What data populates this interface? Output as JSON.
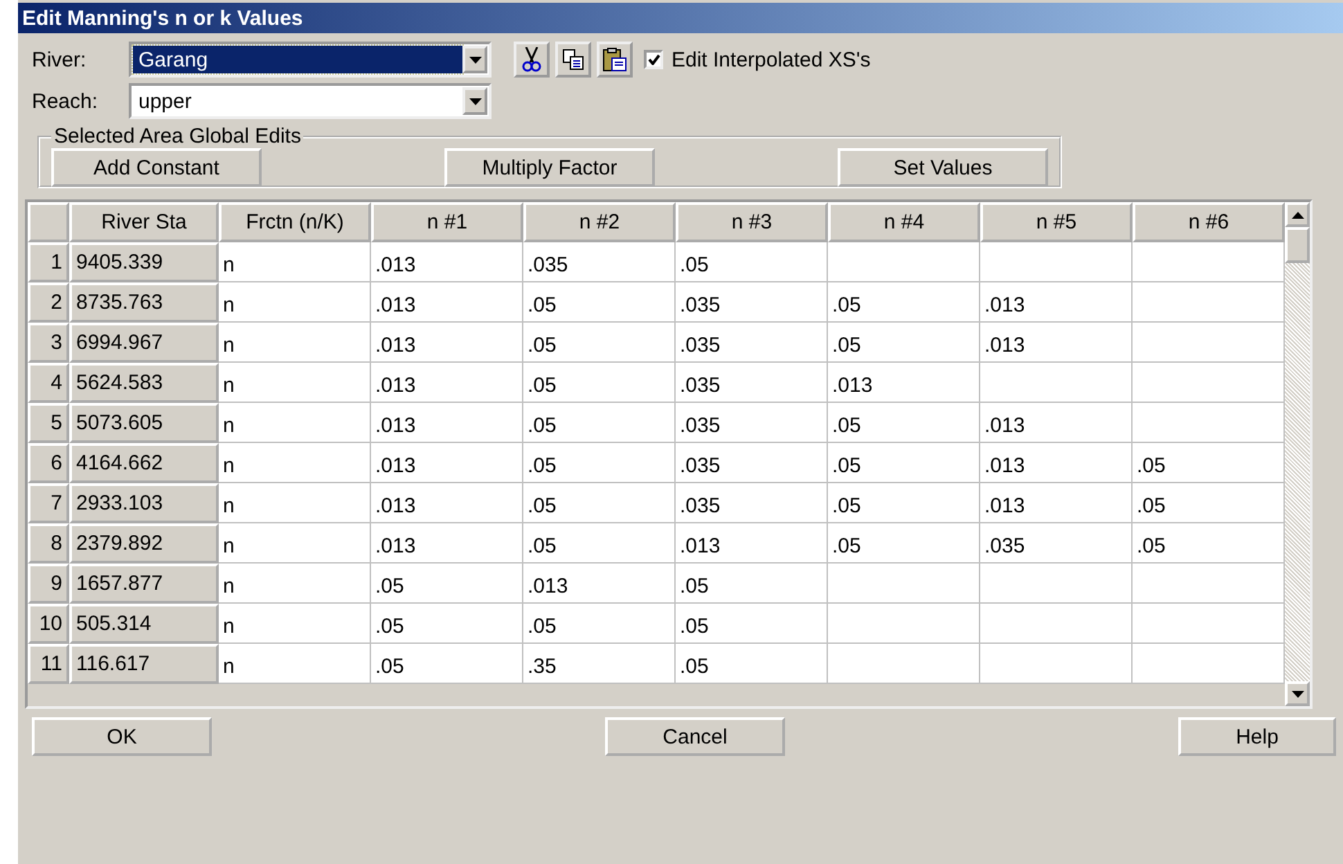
{
  "window": {
    "title": "Edit Manning's n or k Values"
  },
  "river": {
    "label": "River:",
    "value": "Garang",
    "focused": true
  },
  "reach": {
    "label": "Reach:",
    "value": "upper",
    "focused": false
  },
  "toolbar": [
    {
      "kind": "cut"
    },
    {
      "kind": "copy"
    },
    {
      "kind": "paste"
    }
  ],
  "edit_interpolated": {
    "label": "Edit Interpolated XS's",
    "checked": true
  },
  "global_edits": {
    "title": "Selected Area Global Edits",
    "buttons": [
      "Add Constant",
      "Multiply Factor",
      "Set Values"
    ]
  },
  "table": {
    "columns": [
      "River Sta",
      "Frctn (n/K)",
      "n #1",
      "n #2",
      "n #3",
      "n #4",
      "n #5",
      "n #6"
    ],
    "rows": [
      {
        "number": "1",
        "cells": [
          "9405.339",
          "n",
          ".013",
          ".035",
          ".05",
          "",
          "",
          ""
        ]
      },
      {
        "number": "2",
        "cells": [
          "8735.763",
          "n",
          ".013",
          ".05",
          ".035",
          ".05",
          ".013",
          ""
        ]
      },
      {
        "number": "3",
        "cells": [
          "6994.967",
          "n",
          ".013",
          ".05",
          ".035",
          ".05",
          ".013",
          ""
        ]
      },
      {
        "number": "4",
        "cells": [
          "5624.583",
          "n",
          ".013",
          ".05",
          ".035",
          ".013",
          "",
          ""
        ]
      },
      {
        "number": "5",
        "cells": [
          "5073.605",
          "n",
          ".013",
          ".05",
          ".035",
          ".05",
          ".013",
          ""
        ]
      },
      {
        "number": "6",
        "cells": [
          "4164.662",
          "n",
          ".013",
          ".05",
          ".035",
          ".05",
          ".013",
          ".05"
        ]
      },
      {
        "number": "7",
        "cells": [
          "2933.103",
          "n",
          ".013",
          ".05",
          ".035",
          ".05",
          ".013",
          ".05"
        ]
      },
      {
        "number": "8",
        "cells": [
          "2379.892",
          "n",
          ".013",
          ".05",
          ".013",
          ".05",
          ".035",
          ".05"
        ]
      },
      {
        "number": "9",
        "cells": [
          "1657.877",
          "n",
          ".05",
          ".013",
          ".05",
          "",
          "",
          ""
        ]
      },
      {
        "number": "10",
        "cells": [
          "505.314",
          "n",
          ".05",
          ".05",
          ".05",
          "",
          "",
          ""
        ]
      },
      {
        "number": "11",
        "cells": [
          "116.617",
          "n",
          ".05",
          ".35",
          ".05",
          "",
          "",
          ""
        ]
      }
    ]
  },
  "buttons": [
    "OK",
    "Cancel",
    "Help"
  ]
}
